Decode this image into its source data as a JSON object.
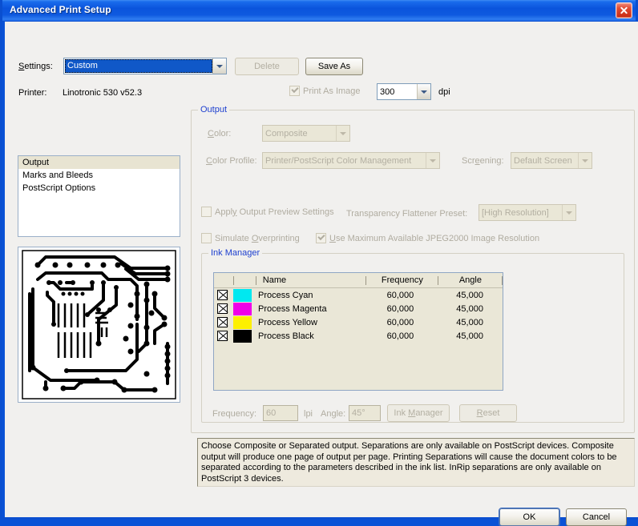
{
  "window": {
    "title": "Advanced Print Setup",
    "close_icon": "close-icon"
  },
  "settings_row": {
    "label": "Settings:",
    "selected": "Custom",
    "delete_label": "Delete",
    "save_as_label": "Save As"
  },
  "printer_row": {
    "label": "Printer:",
    "value": "Linotronic 530 v52.3",
    "print_as_image_label": "Print As Image",
    "print_as_image_checked": true,
    "dpi_value": "300",
    "dpi_unit": "dpi"
  },
  "pagelist": {
    "items": [
      {
        "label": "Output",
        "selected": true
      },
      {
        "label": "Marks and Bleeds",
        "selected": false
      },
      {
        "label": "PostScript Options",
        "selected": false
      }
    ]
  },
  "output_group": {
    "title": "Output",
    "color_label": "Color:",
    "color_value": "Composite",
    "color_profile_label": "Color Profile:",
    "color_profile_value": "Printer/PostScript Color Management",
    "screening_label": "Screening:",
    "screening_value": "Default Screen",
    "apply_output_preview_label": "Apply Output Preview Settings",
    "apply_output_preview_checked": false,
    "flattener_label": "Transparency Flattener Preset:",
    "flattener_value": "[High Resolution]",
    "simulate_overprint_label": "Simulate Overprinting",
    "simulate_overprint_checked": false,
    "jpeg2000_label": "Use Maximum Available JPEG2000 Image Resolution",
    "jpeg2000_checked": true
  },
  "ink_manager": {
    "title": "Ink Manager",
    "columns": [
      "",
      "",
      "Name",
      "Frequency",
      "Angle"
    ],
    "col_name": "Name",
    "col_frequency": "Frequency",
    "col_angle": "Angle",
    "rows": [
      {
        "name": "Process Cyan",
        "frequency": "60,000",
        "angle": "45,000",
        "color": "#00e8f0"
      },
      {
        "name": "Process Magenta",
        "frequency": "60,000",
        "angle": "45,000",
        "color": "#f000e8"
      },
      {
        "name": "Process Yellow",
        "frequency": "60,000",
        "angle": "45,000",
        "color": "#fdf000"
      },
      {
        "name": "Process Black",
        "frequency": "60,000",
        "angle": "45,000",
        "color": "#000000"
      }
    ],
    "frequency_label": "Frequency:",
    "frequency_value": "60",
    "lpi_label": "lpi",
    "angle_label": "Angle:",
    "angle_value": "45°",
    "ink_manager_button": "Ink Manager",
    "reset_button": "Reset"
  },
  "description": "Choose Composite or Separated output. Separations are only available on PostScript devices. Composite output will produce one page of output per page. Printing Separations will cause the document colors to be separated according to the parameters described in the ink list. InRip separations are only available on PostScript 3 devices.",
  "footer": {
    "ok_label": "OK",
    "cancel_label": "Cancel"
  },
  "colors": {
    "titlebar_blue": "#0a54dc",
    "group_title_blue": "#1d3fcf",
    "selection_blue": "#1058c8",
    "disabled_text": "#b0aca0",
    "field_beige": "#eae7d7"
  }
}
